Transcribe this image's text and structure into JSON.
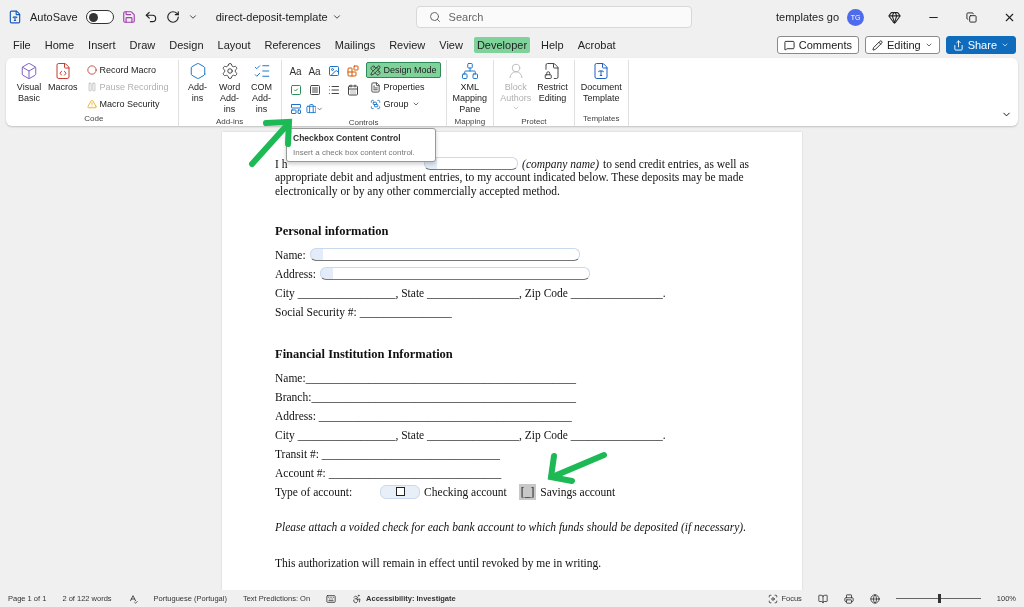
{
  "title_bar": {
    "autosave": {
      "label": "AutoSave",
      "on": false
    },
    "document_title": "direct-deposit-template",
    "search": {
      "placeholder": "Search"
    },
    "user": {
      "name": "templates go",
      "initials": "TG"
    }
  },
  "menu_tabs": [
    {
      "label": "File",
      "selected": false
    },
    {
      "label": "Home",
      "selected": false
    },
    {
      "label": "Insert",
      "selected": false
    },
    {
      "label": "Draw",
      "selected": false
    },
    {
      "label": "Design",
      "selected": false
    },
    {
      "label": "Layout",
      "selected": false
    },
    {
      "label": "References",
      "selected": false
    },
    {
      "label": "Mailings",
      "selected": false
    },
    {
      "label": "Review",
      "selected": false
    },
    {
      "label": "View",
      "selected": false
    },
    {
      "label": "Developer",
      "selected": true
    },
    {
      "label": "Help",
      "selected": false
    },
    {
      "label": "Acrobat",
      "selected": false
    }
  ],
  "header_actions": {
    "comments": "Comments",
    "editing": "Editing",
    "share": "Share"
  },
  "ribbon_groups": [
    {
      "label": "Code",
      "items": [
        {
          "kind": "large",
          "label": "Visual Basic",
          "disabled": false
        },
        {
          "kind": "large",
          "label": "Macros",
          "disabled": false
        },
        {
          "kind": "stack",
          "entries": [
            {
              "label": "Record Macro",
              "disabled": false
            },
            {
              "label": "Pause Recording",
              "disabled": true
            },
            {
              "label": "Macro Security",
              "disabled": false
            }
          ]
        }
      ]
    },
    {
      "label": "Add-ins",
      "items": [
        {
          "kind": "large",
          "label": "Add-ins",
          "disabled": false
        },
        {
          "kind": "large",
          "label": "Word Add-ins",
          "disabled": false
        },
        {
          "kind": "large",
          "label": "COM Add-ins",
          "disabled": false
        }
      ]
    },
    {
      "label": "Controls",
      "items": [
        {
          "kind": "grid",
          "cells": [
            {
              "kind": "text",
              "glyph": "Aa"
            },
            {
              "kind": "text",
              "glyph": "Aa"
            },
            {
              "kind": "icon"
            },
            {
              "kind": "icon"
            },
            {
              "kind": "icon"
            },
            {
              "kind": "icon"
            },
            {
              "kind": "icon"
            },
            {
              "kind": "icon"
            },
            {
              "kind": "icon"
            },
            {
              "kind": "icon"
            }
          ]
        },
        {
          "kind": "stack",
          "entries": [
            {
              "label": "Design Mode",
              "disabled": false,
              "selected": true
            },
            {
              "label": "Properties",
              "disabled": false,
              "selected": false
            },
            {
              "label": "Group",
              "disabled": false,
              "selected": false
            }
          ]
        }
      ]
    },
    {
      "label": "Mapping",
      "items": [
        {
          "kind": "large",
          "label": "XML Mapping Pane",
          "disabled": false
        }
      ]
    },
    {
      "label": "Protect",
      "items": [
        {
          "kind": "large",
          "label": "Block Authors",
          "disabled": true
        },
        {
          "kind": "large",
          "label": "Restrict Editing",
          "disabled": false
        }
      ]
    },
    {
      "label": "Templates",
      "items": [
        {
          "kind": "large",
          "label": "Document Template",
          "disabled": false
        }
      ]
    }
  ],
  "tooltip": {
    "title": "Checkbox Content Control",
    "text": "Insert a check box content control."
  },
  "document": {
    "intro": {
      "lead": "I h",
      "hint": "(company name)",
      "after": "to send credit entries, as well as",
      "rest": "appropriate debit and adjustment entries, to my account indicated below. These deposits may be made electronically or by any other commercially accepted method."
    },
    "sections": [
      {
        "heading": "Personal information",
        "lines": [
          {
            "kind": "control",
            "label": "Name:"
          },
          {
            "kind": "control",
            "label": "Address:"
          },
          {
            "kind": "text",
            "text": "City _________________, State ________________,  Zip Code ________________."
          },
          {
            "kind": "text",
            "text": "Social Security #: ________________"
          }
        ]
      },
      {
        "heading": "Financial Institution Information",
        "lines": [
          {
            "kind": "text",
            "text": "Name:_______________________________________________"
          },
          {
            "kind": "text",
            "text": "Branch:______________________________________________"
          },
          {
            "kind": "text",
            "text": "Address: ____________________________________________"
          },
          {
            "kind": "text",
            "text": "City _________________, State ________________,  Zip Code ________________."
          },
          {
            "kind": "text",
            "text": "Transit #: _______________________________"
          },
          {
            "kind": "text",
            "text": "Account #: ______________________________"
          },
          {
            "kind": "account_type",
            "label": "Type of account:",
            "options": [
              {
                "kind": "control",
                "label": "Checking account",
                "checked": false
              },
              {
                "kind": "legacy",
                "label": "Savings account",
                "checked": false,
                "marker": "[_]"
              }
            ]
          }
        ]
      }
    ],
    "note": "Please attach a voided check for each bank account to which funds should be deposited (if necessary).",
    "closing": "This authorization will remain in effect until revoked by me in writing."
  },
  "status_bar": {
    "page": "Page 1 of 1",
    "words": "2 of 122 words",
    "language": "Portuguese (Portugal)",
    "predictions": "Text Predictions: On",
    "accessibility": "Accessibility: Investigate",
    "focus": "Focus",
    "zoom": {
      "level": 0.5,
      "reading": "100%"
    }
  }
}
